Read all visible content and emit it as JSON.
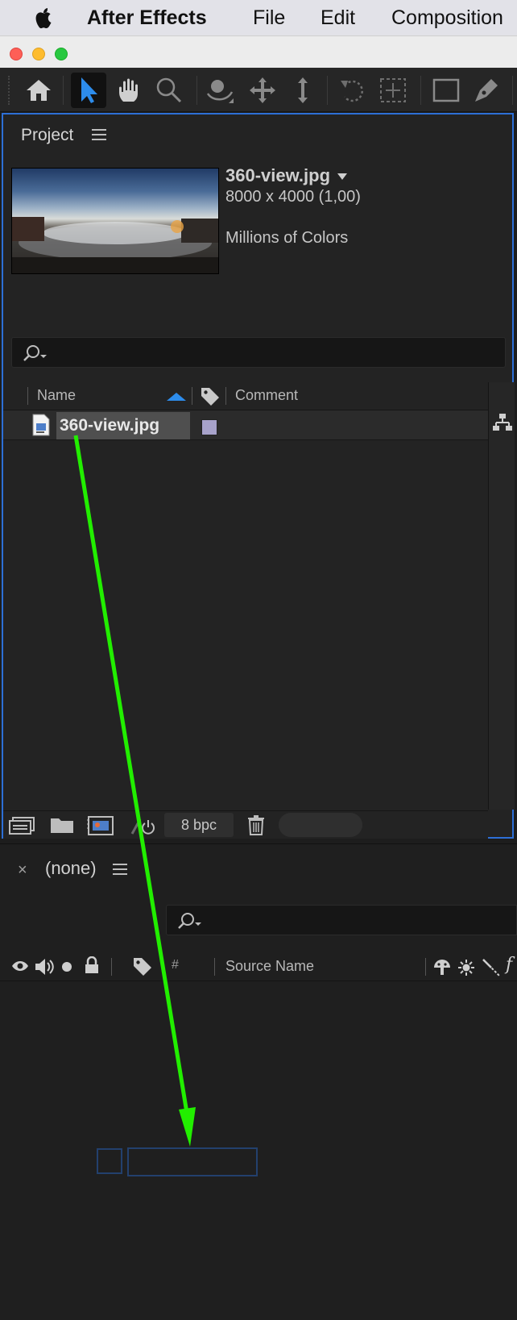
{
  "menubar": {
    "apple_icon": "apple-logo",
    "app_name": "After Effects",
    "items": [
      "File",
      "Edit",
      "Composition"
    ]
  },
  "window": {
    "traffic_lights": {
      "close": "#fe5f57",
      "minimize": "#febc2e",
      "zoom": "#28c840"
    }
  },
  "toolbar": {
    "tools": [
      "home-icon",
      "selection-tool-icon",
      "hand-tool-icon",
      "zoom-tool-icon",
      "orbit-camera-tool-icon",
      "pan-camera-tool-icon",
      "dolly-camera-tool-icon",
      "rotate-tool-icon",
      "pan-behind-tool-icon",
      "rectangle-tool-icon",
      "pen-tool-icon"
    ],
    "selected_tool": "selection-tool-icon",
    "accent": "#2d8ceb"
  },
  "project": {
    "tab_label": "Project",
    "preview": {
      "file_name": "360-view.jpg",
      "dimensions": "8000 x 4000 (1,00)",
      "colors": "Millions of Colors"
    },
    "search": {
      "placeholder": ""
    },
    "columns": {
      "name": "Name",
      "comment": "Comment"
    },
    "items": [
      {
        "name": "360-view.jpg",
        "type_icon": "image-file-icon",
        "label_color": "#a7a2ca"
      }
    ],
    "footer": {
      "bpc": "8 bpc"
    },
    "focus_border": "#2d6fd6"
  },
  "timeline": {
    "close_symbol": "×",
    "tab_label": "(none)",
    "search": {
      "placeholder": ""
    },
    "columns": {
      "number": "#",
      "source_name": "Source Name"
    }
  },
  "annotation": {
    "arrow_color": "#22ee00"
  }
}
